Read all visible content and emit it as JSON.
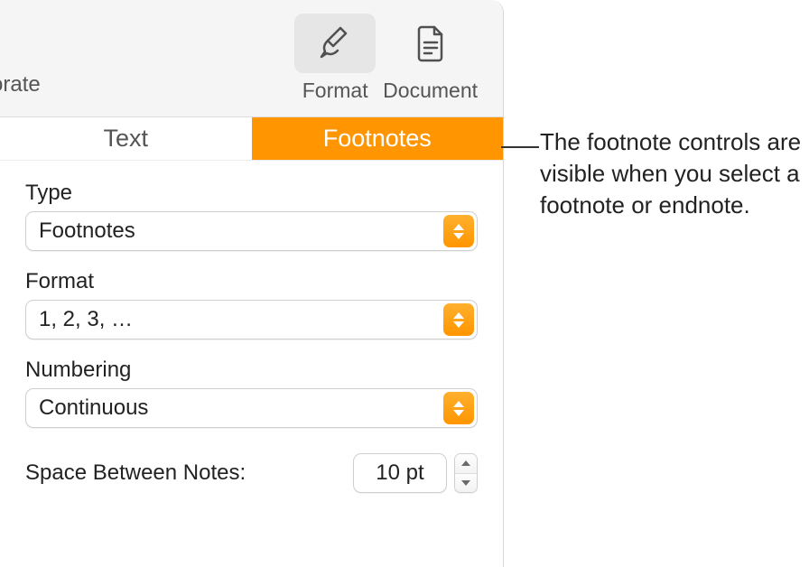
{
  "toolbar": {
    "partial_left_label": "orate",
    "items": [
      {
        "label": "Format",
        "selected": true
      },
      {
        "label": "Document",
        "selected": false
      }
    ]
  },
  "tabs": [
    {
      "label": "Text",
      "active": false
    },
    {
      "label": "Footnotes",
      "active": true
    }
  ],
  "fields": {
    "type": {
      "label": "Type",
      "value": "Footnotes"
    },
    "format": {
      "label": "Format",
      "value": "1, 2, 3, …"
    },
    "numbering": {
      "label": "Numbering",
      "value": "Continuous"
    }
  },
  "space": {
    "label": "Space Between Notes:",
    "value": "10 pt"
  },
  "callout": "The footnote controls are visible when you select a footnote or endnote."
}
